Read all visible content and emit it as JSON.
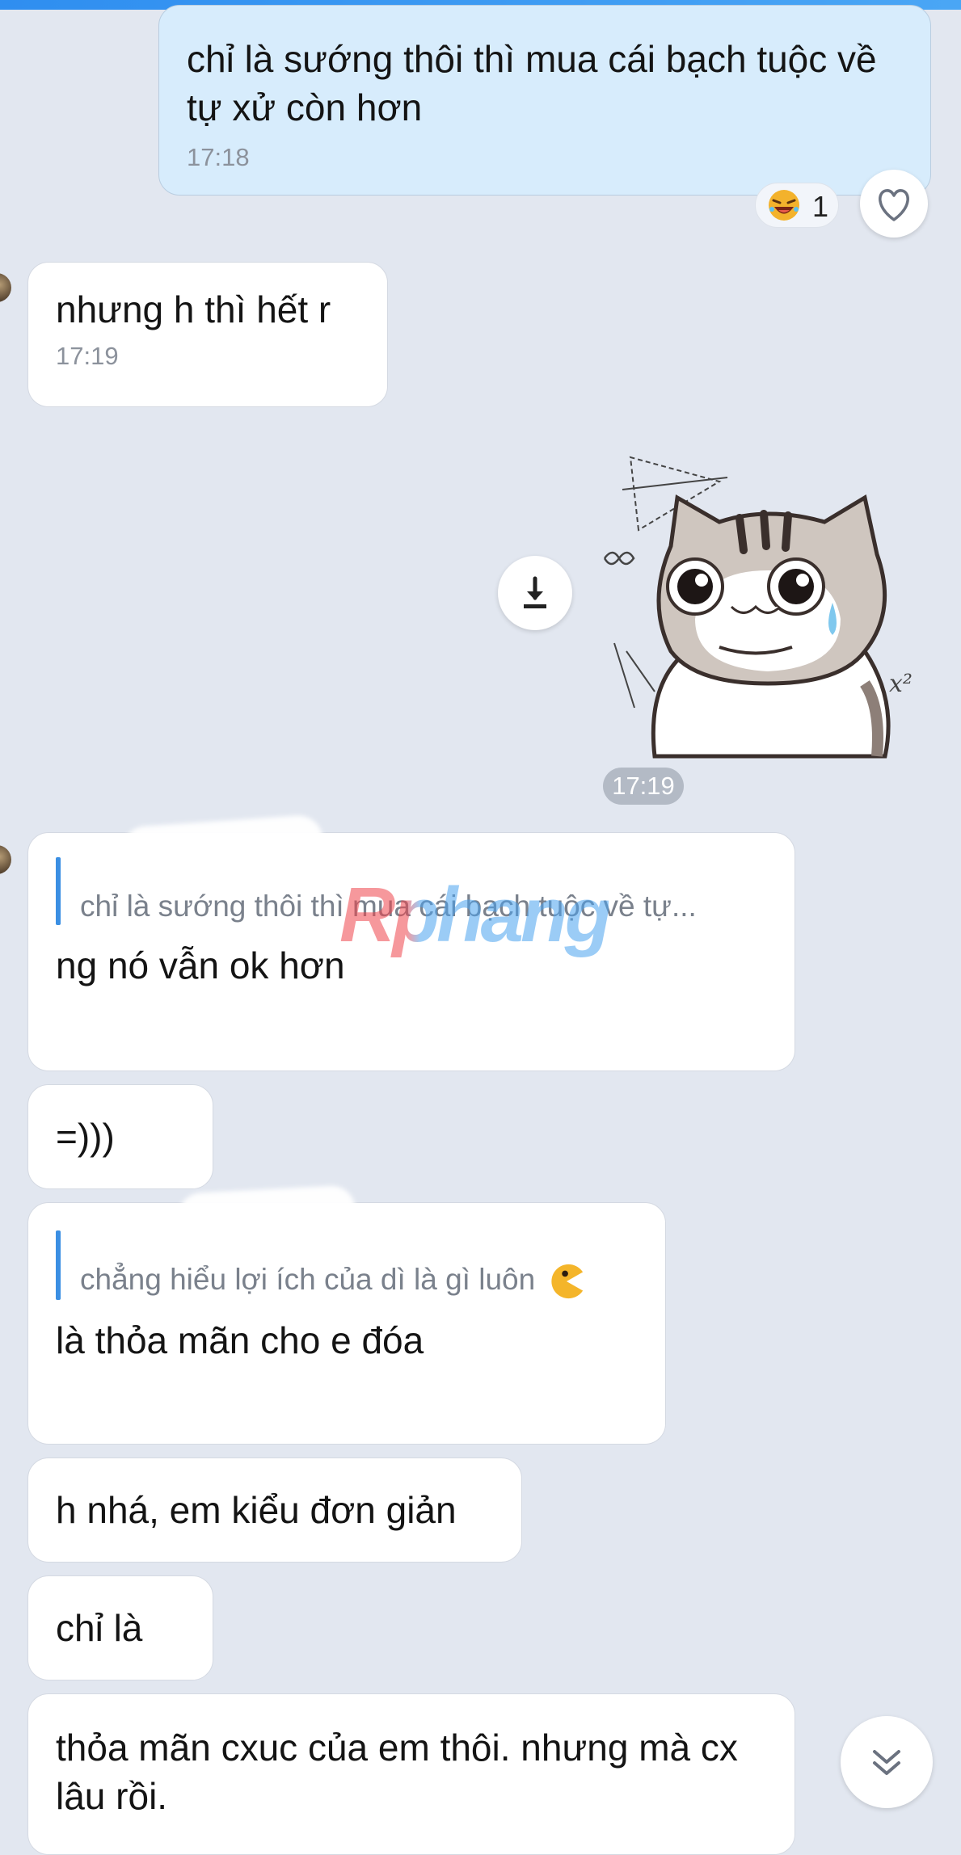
{
  "colors": {
    "accent": "#2f8ef0",
    "background": "#e2e7f0",
    "my_bubble": "#d7ecfc",
    "quote_bar": "#3b8fe3"
  },
  "messages": {
    "m1": {
      "text": "chỉ là sướng thôi thì mua cái bạch tuộc về tự xử còn hơn",
      "time": "17:18",
      "reaction_icon": "laughing-face-icon",
      "reaction_count": "1"
    },
    "m2": {
      "text": "nhưng h thì hết r",
      "time": "17:19"
    },
    "sticker": {
      "icon": "cat-sticker-icon",
      "time": "17:19"
    },
    "m3": {
      "quote_text": "chỉ là sướng thôi thì mua cái bạch tuộc về tự...",
      "text": "ng nó vẫn ok hơn"
    },
    "m4": {
      "text": "=)))"
    },
    "m5": {
      "quote_text": "chẳng hiểu lợi ích của dì là gì luôn",
      "quote_icon": "pacman-emoji-icon",
      "text": "là thỏa mãn cho e đóa"
    },
    "m6": {
      "text": "h nhá, em kiểu đơn giản"
    },
    "m7": {
      "text": "chỉ là"
    },
    "m8": {
      "text": "thỏa mãn cxuc của em thôi. nhưng mà cx lâu rồi."
    }
  },
  "watermark": {
    "text": "Rphang"
  },
  "controls": {
    "download_icon": "download-icon",
    "like_icon": "heart-icon",
    "scroll_icon": "chevron-double-down-icon"
  }
}
